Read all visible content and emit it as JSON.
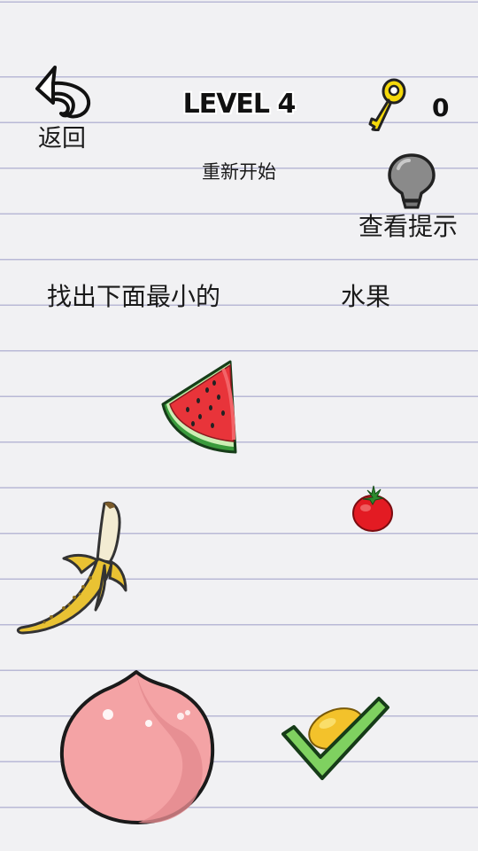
{
  "header": {
    "back_label": "返回",
    "level_title": "LEVEL 4",
    "key_count": "0"
  },
  "controls": {
    "restart_label": "重新开始",
    "hint_label": "查看提示"
  },
  "question": {
    "part1": "找出下面最小的",
    "part2": "水果"
  },
  "icons": {
    "back": "back-arrow-icon",
    "key": "key-icon",
    "hint": "lightbulb-icon",
    "check": "checkmark-icon"
  },
  "fruits": [
    "watermelon",
    "tomato",
    "banana",
    "peach",
    "mango"
  ],
  "colors": {
    "key": "#f5d90a",
    "check": "#7fd160",
    "bulb": "#8a8a8a"
  }
}
